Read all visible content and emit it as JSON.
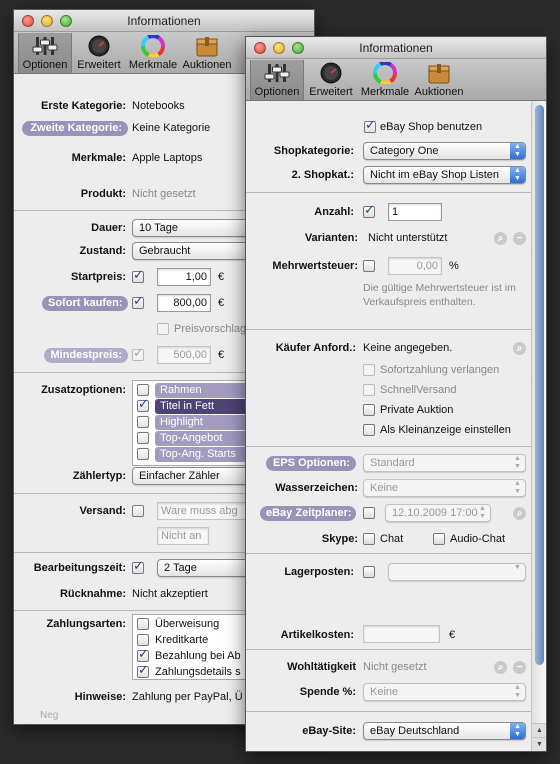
{
  "windows": {
    "back": {
      "title": "Informationen",
      "toolbar": [
        "Optionen",
        "Erweitert",
        "Merkmale",
        "Auktionen"
      ],
      "fields": {
        "erste_kategorie": {
          "label": "Erste Kategorie:",
          "value": "Notebooks"
        },
        "zweite_kategorie": {
          "label": "Zweite Kategorie:",
          "value": "Keine Kategorie"
        },
        "merkmale": {
          "label": "Merkmale:",
          "value": "Apple Laptops"
        },
        "produkt": {
          "label": "Produkt:",
          "value": "Nicht gesetzt"
        },
        "dauer": {
          "label": "Dauer:",
          "value": "10 Tage"
        },
        "zustand": {
          "label": "Zustand:",
          "value": "Gebraucht"
        },
        "startpreis": {
          "label": "Startpreis:",
          "value": "1,00",
          "currency": "€"
        },
        "sofort_kaufen": {
          "label": "Sofort kaufen:",
          "value": "800,00",
          "currency": "€"
        },
        "preisvorschlag": {
          "label": "Preisvorschlag"
        },
        "mindestpreis": {
          "label": "Mindestpreis:",
          "value": "500,00",
          "currency": "€"
        },
        "zusatzoptionen": {
          "label": "Zusatzoptionen:",
          "items": [
            "Rahmen",
            "Titel in Fett",
            "Highlight",
            "Top-Angebot",
            "Top-Ang. Starts"
          ]
        },
        "zaehlertyp": {
          "label": "Zählertyp:",
          "value": "Einfacher Zähler"
        },
        "versand": {
          "label": "Versand:",
          "placeholder1": "Ware muss abg",
          "placeholder2": "Nicht an"
        },
        "bearbeitungszeit": {
          "label": "Bearbeitungszeit:",
          "value": "2 Tage"
        },
        "ruecknahme": {
          "label": "Rücknahme:",
          "value": "Nicht akzeptiert"
        },
        "zahlungsarten": {
          "label": "Zahlungsarten:",
          "items": [
            "Überweisung",
            "Kreditkarte",
            "Bezahlung bei Ab",
            "Zahlungsdetails s"
          ]
        },
        "hinweise": {
          "label": "Hinweise:",
          "value": "Zahlung per PayPal, Ü"
        }
      },
      "footer": "Neg"
    },
    "front": {
      "title": "Informationen",
      "toolbar": [
        "Optionen",
        "Erweitert",
        "Merkmale",
        "Auktionen"
      ],
      "fields": {
        "ebay_shop": {
          "label": "eBay Shop benutzen"
        },
        "shopkategorie": {
          "label": "Shopkategorie:",
          "value": "Category One"
        },
        "shopkat2": {
          "label": "2. Shopkat.:",
          "value": "Nicht im eBay Shop Listen"
        },
        "anzahl": {
          "label": "Anzahl:",
          "value": "1"
        },
        "varianten": {
          "label": "Varianten:",
          "value": "Nicht unterstützt"
        },
        "mehrwertsteuer": {
          "label": "Mehrwertsteuer:",
          "value": "0,00",
          "unit": "%",
          "hint": "Die gültige Mehrwertsteuer ist im Verkaufspreis enthalten."
        },
        "kaeufer_anford": {
          "label": "Käufer Anford.:",
          "value": "Keine angegeben.",
          "items": [
            "Sofortzahlung verlangen",
            "SchnellVersand",
            "Private Auktion",
            "Als Kleinanzeige einstellen"
          ]
        },
        "eps_optionen": {
          "label": "EPS Optionen:",
          "value": "Standard"
        },
        "wasserzeichen": {
          "label": "Wasserzeichen:",
          "value": "Keine"
        },
        "ebay_zeitplaner": {
          "label": "eBay Zeitplaner:",
          "value": "12.10.2009 17:00"
        },
        "skype": {
          "label": "Skype:",
          "chat": "Chat",
          "audio": "Audio-Chat"
        },
        "lagerposten": {
          "label": "Lagerposten:"
        },
        "artikelkosten": {
          "label": "Artikelkosten:",
          "currency": "€"
        },
        "wohltaetigkeit": {
          "label": "Wohltätigkeit",
          "value": "Nicht gesetzt"
        },
        "spende": {
          "label": "Spende %:",
          "value": "Keine"
        },
        "ebay_site": {
          "label": "eBay-Site:",
          "value": "eBay Deutschland"
        }
      }
    }
  },
  "colors": {
    "pill": "#9a92b8",
    "selected_item": "#4e4377",
    "check": "#1a3f9c",
    "blue_popup": "#2f6fd6"
  }
}
